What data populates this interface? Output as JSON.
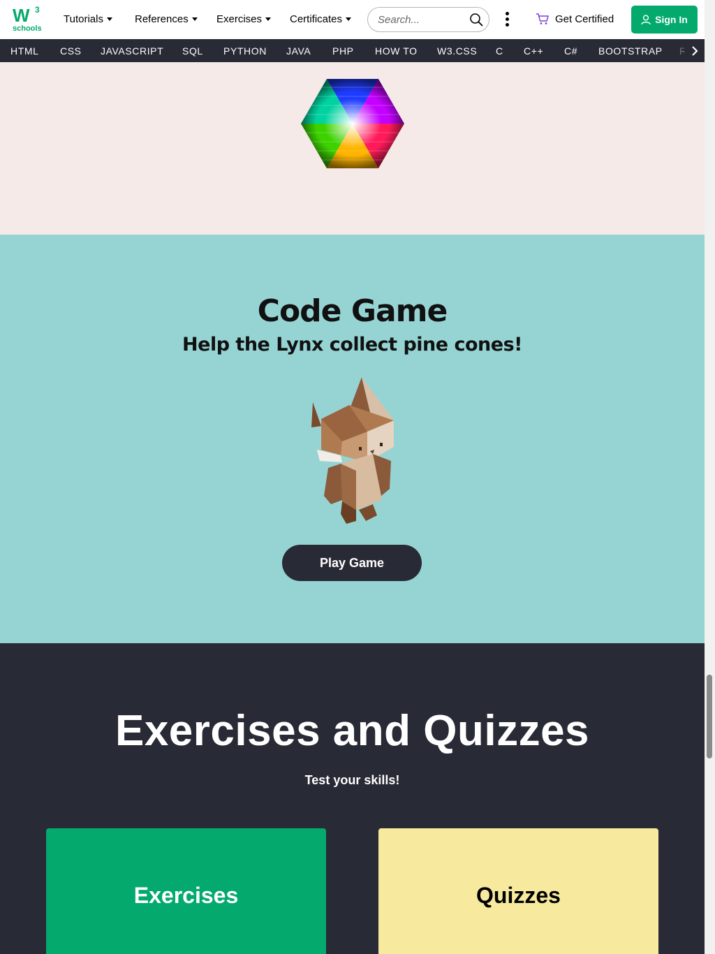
{
  "logo": {
    "mark": "W",
    "superscript": "3",
    "text": "schools",
    "icon": "w3schools-logo"
  },
  "nav": {
    "menus": [
      {
        "label": "Tutorials"
      },
      {
        "label": "References"
      },
      {
        "label": "Exercises"
      },
      {
        "label": "Certificates"
      }
    ],
    "search": {
      "placeholder": "Search...",
      "icon": "search-icon"
    },
    "more_icon": "kebab-menu-icon",
    "get_certified": {
      "label": "Get Certified",
      "icon": "cart-icon"
    },
    "sign_in": {
      "label": "Sign In",
      "icon": "user-icon"
    }
  },
  "languages": [
    "HTML",
    "CSS",
    "JAVASCRIPT",
    "SQL",
    "PYTHON",
    "JAVA",
    "PHP",
    "HOW TO",
    "W3.CSS",
    "C",
    "C++",
    "C#",
    "BOOTSTRAP",
    "R"
  ],
  "languages_next_icon": "chevron-right-icon",
  "color_section": {
    "image": "hex-color-wheel"
  },
  "game": {
    "title": "Code Game",
    "subtitle": "Help the Lynx collect pine cones!",
    "image": "lynx-character",
    "button": "Play Game"
  },
  "exercises": {
    "title": "Exercises and Quizzes",
    "subtitle": "Test your skills!",
    "cards": [
      {
        "label": "Exercises"
      },
      {
        "label": "Quizzes"
      }
    ]
  },
  "colors": {
    "brand_green": "#04aa6d",
    "dark_bar": "#282a35",
    "color_bg": "#f5eae8",
    "game_bg": "#96d4d4",
    "quiz_yellow": "#f7ea9e"
  }
}
